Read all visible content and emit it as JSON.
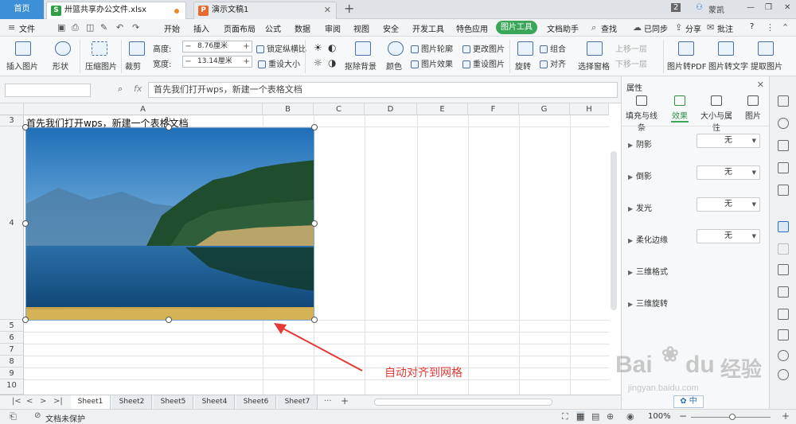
{
  "tabs": {
    "home": "首页",
    "doc1": "卅篮共享办公文件.xlsx",
    "doc2": "演示文稿1",
    "doc1_icon": "S",
    "doc2_icon": "P",
    "page_count": "2",
    "user": "蒙凯"
  },
  "menu": {
    "file": "文件",
    "items": [
      "开始",
      "插入",
      "页面布局",
      "公式",
      "数据",
      "审阅",
      "视图",
      "安全",
      "开发工具",
      "特色应用"
    ],
    "active": "图片工具",
    "doc_helper": "文档助手",
    "search": "查找",
    "sync": "已同步",
    "share": "分享",
    "comment": "批注",
    "help": "?"
  },
  "ribbon": {
    "insert_picture": "插入图片",
    "shape": "形状",
    "compress": "压缩图片",
    "crop": "裁剪",
    "height_label": "高度:",
    "height_value": "8.76厘米",
    "width_label": "宽度:",
    "width_value": "13.14厘米",
    "lock_ratio": "锁定纵横比",
    "reset_size": "重设大小",
    "remove_bg": "抠除背景",
    "color": "颜色",
    "outline": "图片轮廓",
    "effect": "图片效果",
    "change_pic": "更改图片",
    "reset_pic": "重设图片",
    "rotate": "旋转",
    "group": "组合",
    "align": "对齐",
    "select_pane": "选择窗格",
    "bring_forward": "上移一层",
    "send_back": "下移一层",
    "to_pdf": "图片转PDF",
    "to_text": "图片转文字",
    "extract": "提取图片"
  },
  "formula": {
    "fx": "fx",
    "content": "首先我们打开wps，新建一个表格文档"
  },
  "grid": {
    "columns": [
      "A",
      "B",
      "C",
      "D",
      "E",
      "F",
      "G",
      "H"
    ],
    "rows": [
      "3",
      "4",
      "5",
      "6",
      "7",
      "8",
      "9",
      "10"
    ],
    "a3_text": "首先我们打开wps，新建一个表格文档"
  },
  "annotation": "自动对齐到网格",
  "panel": {
    "title": "属性",
    "tabs": [
      "填充与线条",
      "效果",
      "大小与属性",
      "图片"
    ],
    "active_tab": "效果",
    "rows": [
      {
        "label": "阴影",
        "value": "无"
      },
      {
        "label": "倒影",
        "value": "无"
      },
      {
        "label": "发光",
        "value": "无"
      },
      {
        "label": "柔化边缘",
        "value": "无"
      },
      {
        "label": "三维格式",
        "value": ""
      },
      {
        "label": "三维旋转",
        "value": ""
      }
    ]
  },
  "sheets": {
    "names": [
      "Sheet1",
      "Sheet2",
      "Sheet5",
      "Sheet4",
      "Sheet6",
      "Sheet7"
    ],
    "active": "Sheet1",
    "more": "···",
    "add": "+"
  },
  "status": {
    "protect": "文档未保护",
    "zoom": "100%",
    "zoom_fraction": 0.52
  },
  "watermark": {
    "brand": "Bai",
    "paw": "du",
    "experience": "经验",
    "url": "jingyan.baidu.com"
  },
  "ime": "中",
  "colors": {
    "accent": "#3aa657",
    "home_tab": "#3d8fd6",
    "annotation": "#e53935",
    "excel_icon": "#2f9e44",
    "ppt_icon": "#e8692f"
  }
}
